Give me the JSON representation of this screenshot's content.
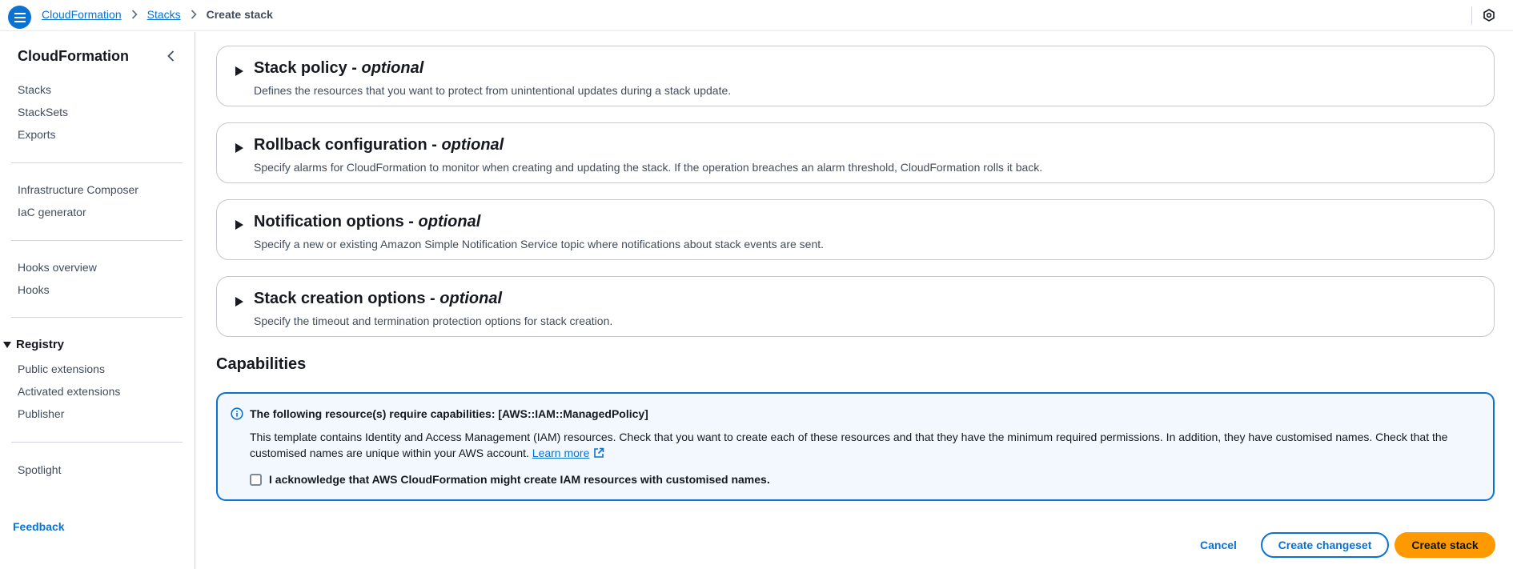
{
  "header": {
    "breadcrumbs": [
      {
        "label": "CloudFormation"
      },
      {
        "label": "Stacks"
      },
      {
        "label": "Create stack"
      }
    ]
  },
  "sidebar": {
    "title": "CloudFormation",
    "group1": [
      "Stacks",
      "StackSets",
      "Exports"
    ],
    "group2": [
      "Infrastructure Composer",
      "IaC generator"
    ],
    "group3": [
      "Hooks overview",
      "Hooks"
    ],
    "registry": {
      "label": "Registry",
      "items": [
        "Public extensions",
        "Activated extensions",
        "Publisher"
      ]
    },
    "group5": [
      "Spotlight"
    ],
    "feedback": "Feedback"
  },
  "panels": [
    {
      "title": "Stack policy - ",
      "optional": "optional",
      "description": "Defines the resources that you want to protect from unintentional updates during a stack update."
    },
    {
      "title": "Rollback configuration - ",
      "optional": "optional",
      "description": "Specify alarms for CloudFormation to monitor when creating and updating the stack. If the operation breaches an alarm threshold, CloudFormation rolls it back."
    },
    {
      "title": "Notification options - ",
      "optional": "optional",
      "description": "Specify a new or existing Amazon Simple Notification Service topic where notifications about stack events are sent."
    },
    {
      "title": "Stack creation options - ",
      "optional": "optional",
      "description": "Specify the timeout and termination protection options for stack creation."
    }
  ],
  "capabilities": {
    "title": "Capabilities",
    "alert_heading": "The following resource(s) require capabilities: [AWS::IAM::ManagedPolicy]",
    "alert_body": "This template contains Identity and Access Management (IAM) resources. Check that you want to create each of these resources and that they have the minimum required permissions. In addition, they have customised names. Check that the customised names are unique within your AWS account.",
    "learn_more": "Learn more",
    "acknowledge_label": "I acknowledge that AWS CloudFormation might create IAM resources with customised names.",
    "acknowledged": false
  },
  "actions": {
    "cancel": "Cancel",
    "create_changeset": "Create changeset",
    "create_stack": "Create stack"
  },
  "colors": {
    "link": "#0972d3",
    "primary_button": "#ff9900",
    "alert_background": "#f2f8fd",
    "alert_border": "#0972d3"
  },
  "icons": {
    "menu": "hamburger-icon",
    "settings": "hexagon-settings-icon",
    "collapse": "chevron-left-icon",
    "expand": "caret-right-icon",
    "info": "info-circle-icon",
    "external": "external-link-icon"
  }
}
